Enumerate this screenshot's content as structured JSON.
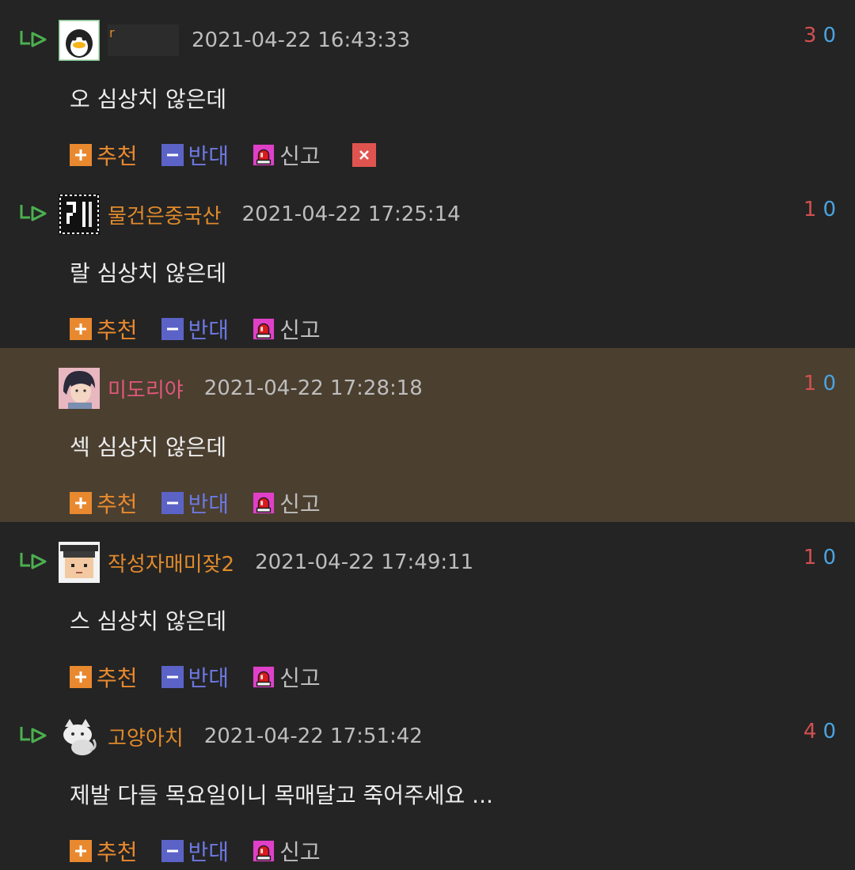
{
  "colors": {
    "background": "#242424",
    "highlight_background": "#4b3f30",
    "nickname": "#e08a2b",
    "nickname_highlight": "#e0587a",
    "upvote": "#d25050",
    "downvote": "#4aa3e0",
    "recommend": "#e8892f",
    "oppose": "#6c78e0"
  },
  "actions": {
    "recommend": "추천",
    "oppose": "반대",
    "report": "신고"
  },
  "comments": [
    {
      "nickname": "r",
      "timestamp": "2021-04-22 16:43:33",
      "upvotes": "3",
      "downvotes": "0",
      "text": "오 심상치 않은데",
      "avatar_icon": "penguin-avatar-icon"
    },
    {
      "nickname": "물건은중국산",
      "timestamp": "2021-04-22 17:25:14",
      "upvotes": "1",
      "downvotes": "0",
      "text": "랄 심상치 않은데",
      "avatar_icon": "pixel-avatar-icon"
    },
    {
      "nickname": "미도리야",
      "timestamp": "2021-04-22 17:28:18",
      "upvotes": "1",
      "downvotes": "0",
      "text": "섹 심상치 않은데",
      "avatar_icon": "anime-avatar-icon"
    },
    {
      "nickname": "작성자매미잦2",
      "timestamp": "2021-04-22 17:49:11",
      "upvotes": "1",
      "downvotes": "0",
      "text": "스 심상치 않은데",
      "avatar_icon": "pixel-face-avatar-icon"
    },
    {
      "nickname": "고양아치",
      "timestamp": "2021-04-22 17:51:42",
      "upvotes": "4",
      "downvotes": "0",
      "text": "제발 다들 목요일이니 목매달고 죽어주세요 ...",
      "avatar_icon": "cat-avatar-icon"
    }
  ]
}
